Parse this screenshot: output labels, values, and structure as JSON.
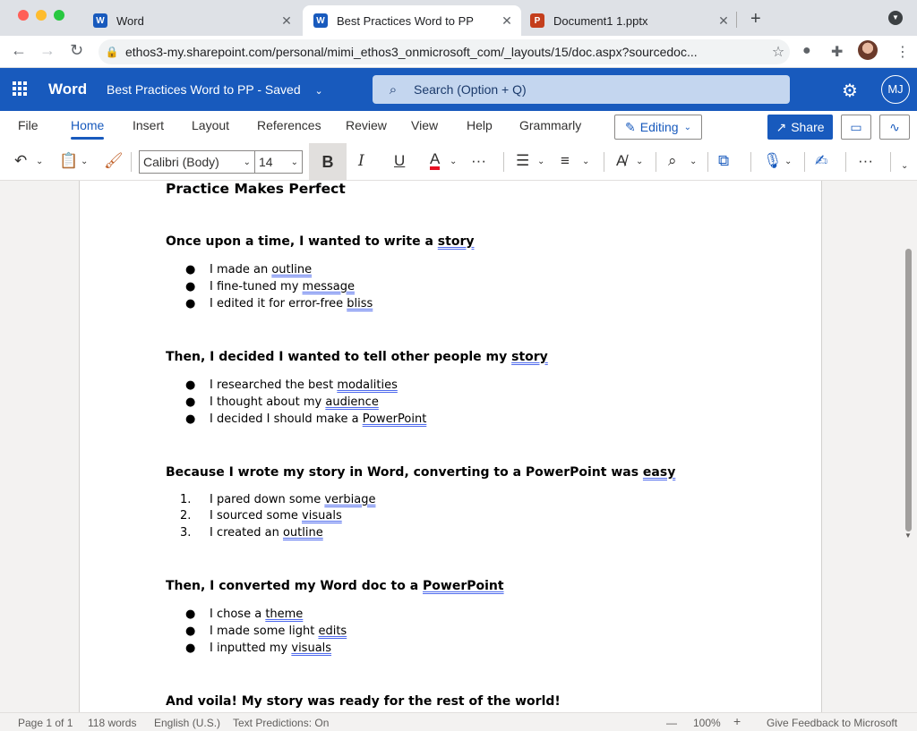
{
  "browser": {
    "tabs": [
      {
        "label": "Word",
        "icon": "word-icon"
      },
      {
        "label": "Best Practices Word to PP",
        "icon": "word-icon"
      },
      {
        "label": "Document1 1.pptx",
        "icon": "powerpoint-icon"
      }
    ],
    "url": "ethos3-my.sharepoint.com/personal/mimi_ethos3_onmicrosoft_com/_layouts/15/doc.aspx?sourcedoc..."
  },
  "app": {
    "name": "Word",
    "doc_title": "Best Practices Word to PP",
    "save_status": "Saved",
    "search_placeholder": "Search (Option + Q)",
    "user_initials": "MJ",
    "brand_color": "#185abd"
  },
  "ribbon": {
    "tabs": [
      "File",
      "Home",
      "Insert",
      "Layout",
      "References",
      "Review",
      "View",
      "Help",
      "Grammarly"
    ],
    "active_tab": "Home",
    "editing_label": "Editing",
    "share_label": "Share"
  },
  "toolbar": {
    "font_name": "Calibri (Body)",
    "font_size": "14",
    "bold": "B",
    "italic": "I",
    "underline": "U",
    "font_color": "A",
    "more": "···"
  },
  "document": {
    "title": "Practice Makes Perfect",
    "sections": [
      {
        "heading_prefix": "Once upon a time, I wanted to write a ",
        "heading_mark": "story",
        "list_type": "bullet",
        "items": [
          {
            "text": "I made an ",
            "mark": "outline"
          },
          {
            "text": "I fine-tuned my ",
            "mark": "message"
          },
          {
            "text": "I edited it for error-free ",
            "mark": "bliss"
          }
        ]
      },
      {
        "heading_prefix": "Then, I decided I wanted to tell other people my ",
        "heading_mark": "story",
        "list_type": "bullet",
        "items": [
          {
            "text": "I researched the best ",
            "mark": "modalities"
          },
          {
            "text": "I thought about my ",
            "mark": "audience"
          },
          {
            "text": "I decided I should make a ",
            "mark": "PowerPoint"
          }
        ]
      },
      {
        "heading_prefix": "Because I wrote my story in Word, converting to a PowerPoint was ",
        "heading_mark": "easy",
        "list_type": "numbered",
        "items": [
          {
            "num": "1.",
            "text": "I pared down some ",
            "mark": "verbiage"
          },
          {
            "num": "2.",
            "text": "I sourced some ",
            "mark": "visuals"
          },
          {
            "num": "3.",
            "text": "I created an ",
            "mark": "outline"
          }
        ]
      },
      {
        "heading_prefix": "Then, I converted my Word doc to a ",
        "heading_mark": "PowerPoint",
        "list_type": "bullet",
        "items": [
          {
            "text": "I chose a ",
            "mark": "theme"
          },
          {
            "text": "I made some light ",
            "mark": "edits"
          },
          {
            "text": "I inputted my ",
            "mark": "visuals"
          }
        ]
      }
    ],
    "closing": "And voila! My story was ready for the rest of the world!"
  },
  "status": {
    "page": "Page 1 of 1",
    "words": "118 words",
    "language": "English (U.S.)",
    "predictions": "Text Predictions: On",
    "zoom_minus": "—",
    "zoom": "100%",
    "zoom_plus": "+",
    "feedback": "Give Feedback to Microsoft"
  }
}
